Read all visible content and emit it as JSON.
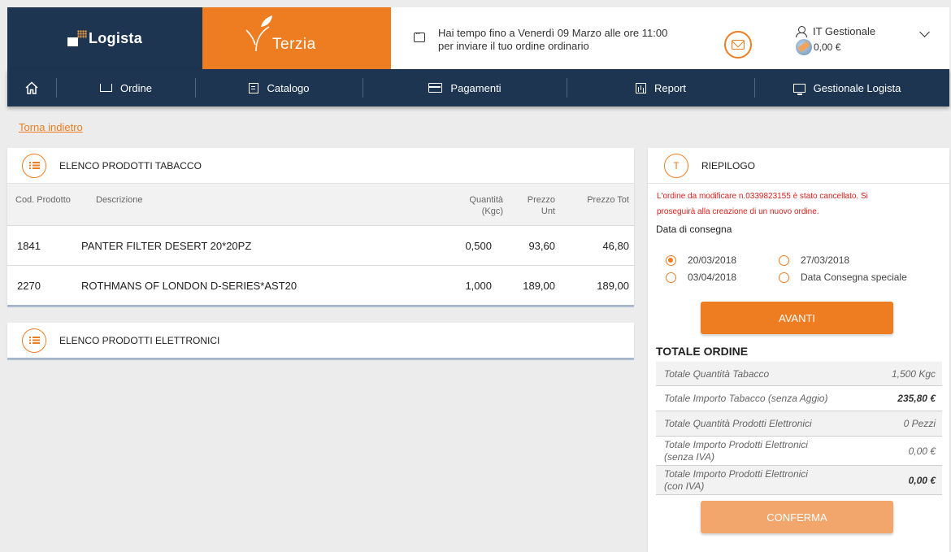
{
  "header": {
    "logista": "Logista",
    "terzia": "Terzia",
    "notice_line1": "Hai tempo fino a Venerdì 09 Marzo alle ore 11:00",
    "notice_line2": "per inviare il tuo ordine ordinario",
    "user_name": "IT Gestionale",
    "credit": "0,00 €"
  },
  "nav": {
    "items": [
      {
        "label": "Ordine",
        "icon": "cart-icon"
      },
      {
        "label": "Catalogo",
        "icon": "catalog-icon"
      },
      {
        "label": "Pagamenti",
        "icon": "card-icon"
      },
      {
        "label": "Report",
        "icon": "report-icon"
      },
      {
        "label": "Gestionale Logista",
        "icon": "monitor-icon"
      }
    ]
  },
  "back_link": "Torna indietro",
  "tobacco": {
    "title": "ELENCO PRODOTTI TABACCO",
    "columns": {
      "code": "Cod. Prodotto",
      "desc": "Descrizione",
      "qty1": "Quantità",
      "qty2": "(Kgc)",
      "unit1": "Prezzo",
      "unit2": "Unt",
      "tot": "Prezzo Tot"
    },
    "rows": [
      {
        "code": "1841",
        "desc": "PANTER FILTER DESERT 20*20PZ",
        "qty": "0,500",
        "unit": "93,60",
        "tot": "46,80"
      },
      {
        "code": "2270",
        "desc": "ROTHMANS OF LONDON D-SERIES*AST20",
        "qty": "1,000",
        "unit": "189,00",
        "tot": "189,00"
      }
    ]
  },
  "electronics": {
    "title": "ELENCO PRODOTTI ELETTRONICI"
  },
  "summary": {
    "icon_letter": "T",
    "title": "RIEPILOGO",
    "warning_line1": "L'ordine da modificare n.0339823155 è stato cancellato. Si",
    "warning_line2": "proseguirà alla creazione di un nuovo ordine.",
    "delivery_label": "Data di consegna",
    "options": [
      {
        "label": "20/03/2018",
        "selected": true
      },
      {
        "label": "27/03/2018",
        "selected": false
      },
      {
        "label": "03/04/2018",
        "selected": false
      },
      {
        "label": "Data Consegna speciale",
        "selected": false
      }
    ],
    "next_button": "AVANTI",
    "totals_title": "TOTALE ORDINE",
    "totals": [
      {
        "label": "Totale Quantità Tabacco",
        "value": "1,500 Kgc"
      },
      {
        "label": "Totale Importo Tabacco (senza Aggio)",
        "value": "235,80 €"
      },
      {
        "label": "Totale Quantità Prodotti Elettronici",
        "value": "0 Pezzi"
      },
      {
        "label": "Totale Importo Prodotti Elettronici",
        "label2": "(senza IVA)",
        "value": "0,00 €"
      },
      {
        "label": "Totale Importo Prodotti Elettronici",
        "label2": "(con IVA)",
        "value": "0,00 €"
      }
    ],
    "confirm_button": "CONFERMA"
  },
  "colors": {
    "navy": "#1d3551",
    "orange": "#ee7d22",
    "error": "#d9201c"
  }
}
